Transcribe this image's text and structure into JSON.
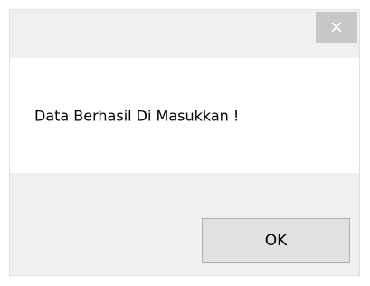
{
  "dialog": {
    "message": "Data Berhasil Di Masukkan !",
    "close_icon": "close-icon",
    "ok_label": "OK"
  },
  "colors": {
    "titlebar": "#f0f0f0",
    "close_button_bg": "#c7c7c7",
    "content_bg": "#ffffff",
    "footer_bg": "#f0f0f0",
    "button_bg": "#e1e1e1",
    "button_border": "#adadad"
  }
}
